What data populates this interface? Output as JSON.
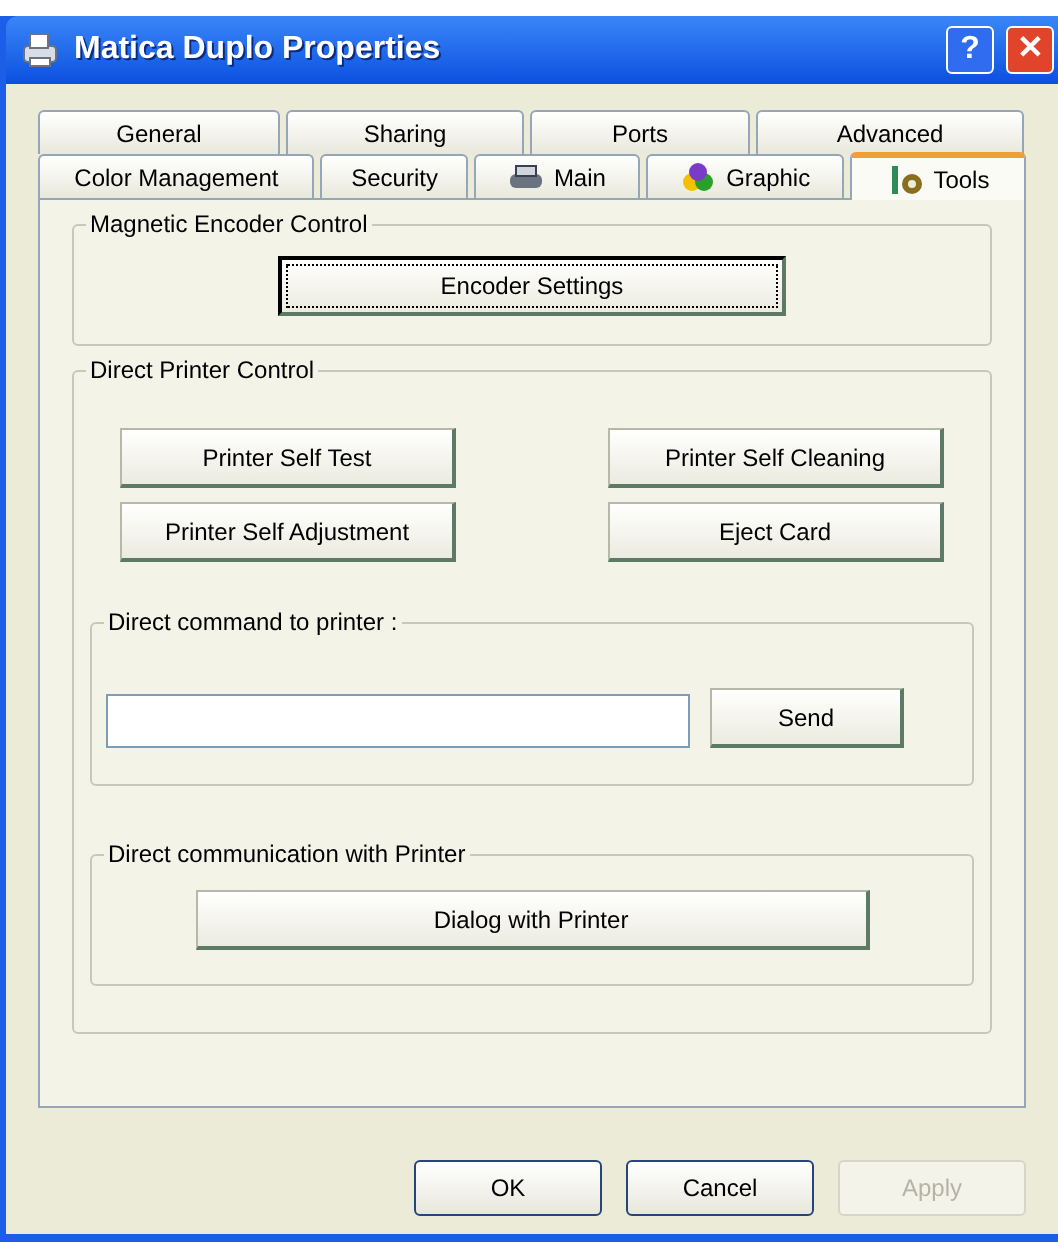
{
  "window": {
    "title": "Matica Duplo Properties",
    "title_buttons": [
      {
        "kind": "help",
        "label": "?"
      },
      {
        "kind": "close",
        "label": "✕"
      }
    ]
  },
  "tab_rows": [
    [
      {
        "label": "General",
        "selected": false
      },
      {
        "label": "Sharing",
        "selected": false
      },
      {
        "label": "Ports",
        "selected": false
      },
      {
        "label": "Advanced",
        "selected": false
      }
    ],
    [
      {
        "label": "Color Management",
        "selected": false
      },
      {
        "label": "Security",
        "selected": false
      },
      {
        "label": "Main",
        "selected": false,
        "kind": "printer"
      },
      {
        "label": "Graphic",
        "selected": false,
        "kind": "color"
      },
      {
        "label": "Tools",
        "selected": true,
        "kind": "tools"
      }
    ]
  ],
  "magnetic_encoder_control": {
    "title": "Magnetic Encoder Control",
    "button": {
      "label": "Encoder Settings",
      "focused": true
    }
  },
  "direct_printer_control": {
    "title": "Direct Printer Control",
    "buttons": [
      {
        "label": "Printer Self Test"
      },
      {
        "label": "Printer Self Cleaning"
      },
      {
        "label": "Printer Self Adjustment"
      },
      {
        "label": "Eject Card"
      }
    ],
    "direct_command": {
      "title": "Direct command to printer :",
      "send_button": "Send"
    },
    "direct_communication": {
      "title": "Direct communication with Printer",
      "button": "Dialog with Printer"
    }
  },
  "footer_buttons": [
    {
      "label": "OK",
      "disabled": false
    },
    {
      "label": "Cancel",
      "disabled": false
    },
    {
      "label": "Apply",
      "disabled": true
    }
  ]
}
